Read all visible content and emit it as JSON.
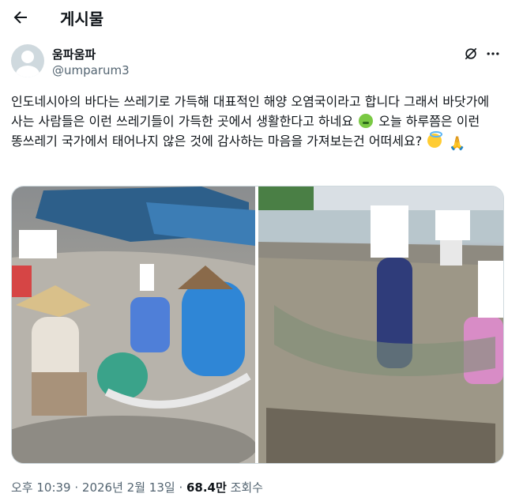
{
  "header": {
    "title": "게시물"
  },
  "author": {
    "name": "움파움파",
    "handle": "@umparum3"
  },
  "tweet": {
    "text_1": "인도네시아의 바다는 쓰레기로 가득해 대표적인 해양 오염국이라고 합니다 그래서 바닷가에 사는 사람들은 이런 쓰레기들이 가득한 곳에서 생활한다고 하네요 ",
    "text_2": " 오늘 하루쯤은 이런 똥쓰레기 국가에서 태어나지 않은 것에 감사하는 마음을 가져보는건 어떠세요? ",
    "emoji_pray": "🙏"
  },
  "meta": {
    "time": "오후 10:39",
    "sep1": " · ",
    "date": "2026년 2월 13일",
    "sep2": " · ",
    "views_count": "68.4만",
    "views_label": " 조회수"
  },
  "icons": [
    "back-arrow-icon",
    "grok-icon",
    "more-icon",
    "avatar-icon",
    "nauseated-face-emoji",
    "smiling-halo-emoji",
    "folded-hands-emoji"
  ]
}
